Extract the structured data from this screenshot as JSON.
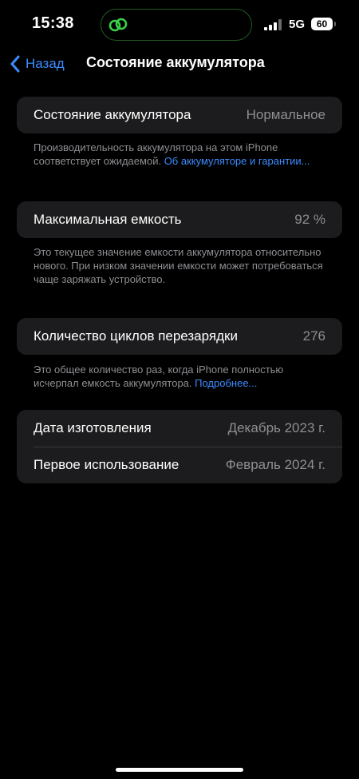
{
  "status_bar": {
    "time": "15:38",
    "network": "5G",
    "battery_level": "60",
    "island_activity_icon": "link-icon"
  },
  "nav": {
    "back_label": "Назад",
    "title": "Состояние аккумулятора"
  },
  "battery_health": {
    "label": "Состояние аккумулятора",
    "value": "Нормальное",
    "footer_text": "Производительность аккумулятора на этом iPhone соответствует ожидаемой. ",
    "footer_link": "Об аккумуляторе и гарантии..."
  },
  "max_capacity": {
    "label": "Максимальная емкость",
    "value": "92 %",
    "footer_text": "Это текущее значение емкости аккумулятора относительно нового. При низком значении емкости может потребоваться чаще заряжать устройство."
  },
  "cycle_count": {
    "label": "Количество циклов перезарядки",
    "value": "276",
    "footer_text": "Это общее количество раз, когда iPhone полностью исчерпал емкость аккумулятора. ",
    "footer_link": "Подробнее..."
  },
  "dates": {
    "manufacture_label": "Дата изготовления",
    "manufacture_value": "Декабрь 2023 г.",
    "first_use_label": "Первое использование",
    "first_use_value": "Февраль 2024 г."
  },
  "colors": {
    "accent": "#3c8cff",
    "background": "#000000",
    "cell": "#1c1c1e",
    "secondary_text": "#8e8e93"
  }
}
